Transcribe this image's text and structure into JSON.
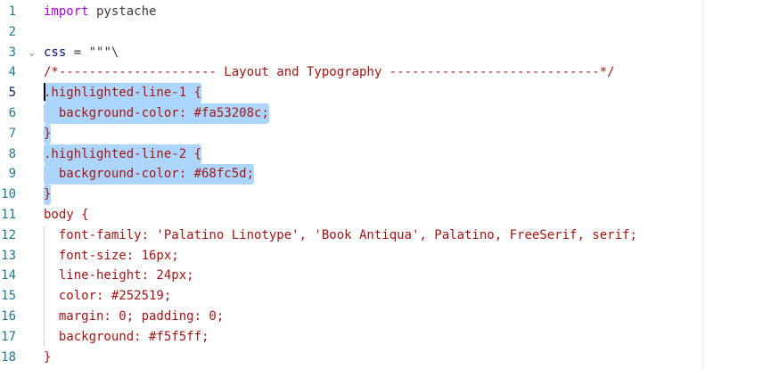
{
  "editor": {
    "line_numbers": [
      "1",
      "2",
      "3",
      "4",
      "5",
      "6",
      "7",
      "8",
      "9",
      "10",
      "11",
      "12",
      "13",
      "14",
      "15",
      "16",
      "17",
      "18"
    ],
    "lines": [
      {
        "text": "import pystache"
      },
      {
        "text": ""
      },
      {
        "text": "css = \"\"\"\\"
      },
      {
        "text": "/*--------------------- Layout and Typography ----------------------------*/"
      },
      {
        "text": ".highlighted-line-1 {"
      },
      {
        "text": "  background-color: #fa53208c;"
      },
      {
        "text": "}"
      },
      {
        "text": ".highlighted-line-2 {"
      },
      {
        "text": "  background-color: #68fc5d;"
      },
      {
        "text": "}"
      },
      {
        "text": "body {"
      },
      {
        "text": "  font-family: 'Palatino Linotype', 'Book Antiqua', Palatino, FreeSerif, serif;"
      },
      {
        "text": "  font-size: 16px;"
      },
      {
        "text": "  line-height: 24px;"
      },
      {
        "text": "  color: #252519;"
      },
      {
        "text": "  margin: 0; padding: 0;"
      },
      {
        "text": "  background: #f5f5ff;"
      },
      {
        "text": "}"
      }
    ],
    "line1_keyword": "import",
    "line1_module": " pystache",
    "line3_var": "css",
    "line3_rest": " = \"\"\"\\",
    "fold_icon": "chevron-down-icon",
    "selection_color": "#add6ff",
    "string_color": "#a31515",
    "keyword_color": "#af00db",
    "line_number_color": "#237893"
  }
}
